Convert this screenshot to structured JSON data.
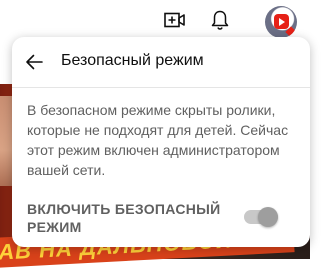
{
  "header": {
    "icons": [
      "create-video-icon",
      "notifications-bell-icon",
      "account-avatar"
    ]
  },
  "background": {
    "banner_text": "АВ НА ДАЛЬНОБОЙ"
  },
  "menu": {
    "title": "Безопасный режим",
    "back_icon": "arrow-left-icon",
    "description": "В безопасном режиме скрыты ролики, которые не подходят для детей. Сейчас этот режим включен администратором вашей сети.",
    "toggle_label": "ВКЛЮЧИТЬ БЕЗОПАСНЫЙ РЕЖИМ",
    "toggle_state": "on-disabled"
  },
  "colors": {
    "text_primary": "#0f0f0f",
    "text_secondary": "#606060",
    "toggle_track": "#c8c8c8",
    "toggle_knob": "#9e9e9e",
    "avatar_accent": "#e62117"
  }
}
